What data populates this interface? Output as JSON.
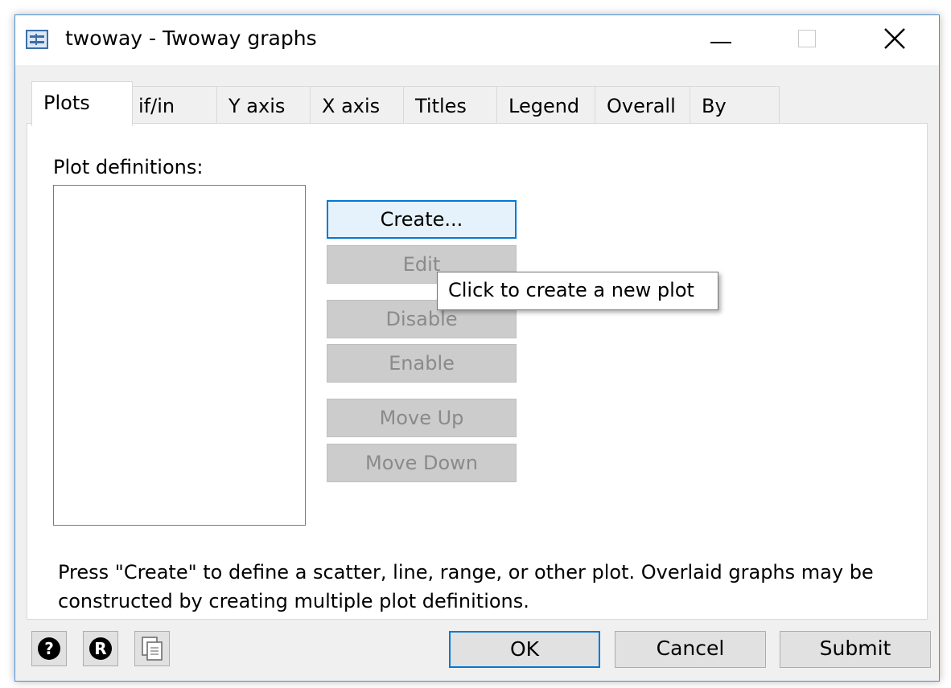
{
  "window": {
    "title": "twoway - Twoway graphs"
  },
  "tabs": [
    {
      "label": "Plots",
      "active": true
    },
    {
      "label": "if/in"
    },
    {
      "label": "Y axis"
    },
    {
      "label": "X axis"
    },
    {
      "label": "Titles"
    },
    {
      "label": "Legend"
    },
    {
      "label": "Overall"
    },
    {
      "label": "By"
    }
  ],
  "plots_panel": {
    "label": "Plot definitions:",
    "buttons": {
      "create": "Create...",
      "edit": "Edit",
      "disable": "Disable",
      "enable": "Enable",
      "move_up": "Move Up",
      "move_down": "Move Down"
    },
    "tooltip": "Click to create a new plot",
    "help_text": "Press \"Create\" to define a scatter, line, range, or other plot. Overlaid graphs may be constructed by creating multiple plot definitions."
  },
  "footer": {
    "help_glyph": "?",
    "reset_glyph": "R",
    "ok": "OK",
    "cancel": "Cancel",
    "submit": "Submit"
  },
  "colors": {
    "accent": "#0078d7",
    "window_border": "#4a8fd6",
    "disabled_button": "#cccccc",
    "disabled_text": "#8a8a8a"
  },
  "icons": [
    "app-dialog-icon",
    "minimize-icon",
    "maximize-icon",
    "close-icon",
    "help-icon",
    "reset-icon",
    "copy-icon"
  ]
}
